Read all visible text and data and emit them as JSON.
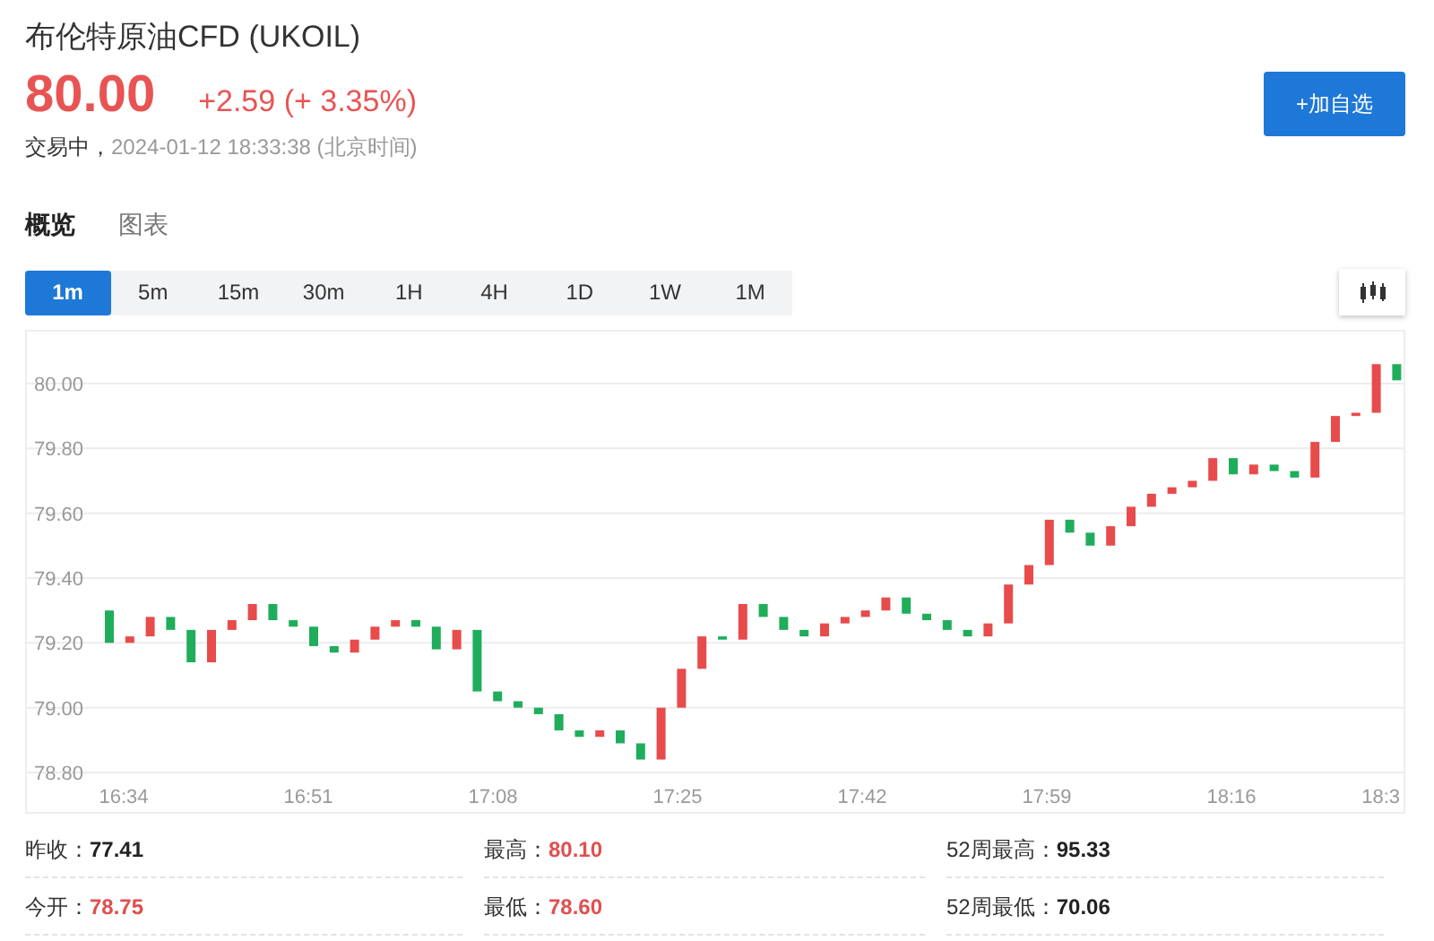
{
  "header": {
    "title": "布伦特原油CFD",
    "symbol": "(UKOIL)",
    "price": "80.00",
    "change": "+2.59",
    "change_pct": "(+ 3.35%)",
    "status": "交易中，",
    "timestamp": "2024-01-12 18:33:38",
    "timezone": "(北京时间)",
    "add_button": "+加自选"
  },
  "tabs": [
    {
      "label": "概览",
      "selected": true
    },
    {
      "label": "图表",
      "selected": false
    }
  ],
  "intervals": [
    {
      "label": "1m",
      "selected": true
    },
    {
      "label": "5m",
      "selected": false
    },
    {
      "label": "15m",
      "selected": false
    },
    {
      "label": "30m",
      "selected": false
    },
    {
      "label": "1H",
      "selected": false
    },
    {
      "label": "4H",
      "selected": false
    },
    {
      "label": "1D",
      "selected": false
    },
    {
      "label": "1W",
      "selected": false
    },
    {
      "label": "1M",
      "selected": false
    }
  ],
  "chart": {
    "y_labels": [
      "80.00",
      "79.80",
      "79.60",
      "79.40",
      "79.20",
      "79.00",
      "78.80"
    ],
    "x_labels": [
      "16:34",
      "16:51",
      "17:08",
      "17:25",
      "17:42",
      "17:59",
      "18:16",
      "18:3"
    ]
  },
  "stats": [
    {
      "label": "昨收：",
      "value": "77.41",
      "color": "#222222"
    },
    {
      "label": "最高：",
      "value": "80.10",
      "color": "#e04f4f"
    },
    {
      "label": "52周最高：",
      "value": "95.33",
      "color": "#222222"
    },
    {
      "label": "今开：",
      "value": "78.75",
      "color": "#e04f4f"
    },
    {
      "label": "最低：",
      "value": "78.60",
      "color": "#e04f4f"
    },
    {
      "label": "52周最低：",
      "value": "70.06",
      "color": "#222222"
    }
  ]
}
